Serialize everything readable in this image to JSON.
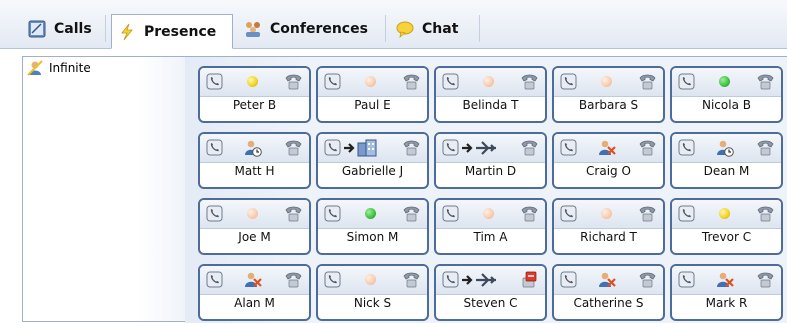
{
  "tabs": [
    {
      "label": "Calls",
      "icon": "calls-icon",
      "active": false
    },
    {
      "label": "Presence",
      "icon": "presence-lightning-icon",
      "active": true
    },
    {
      "label": "Conferences",
      "icon": "conferences-icon",
      "active": false
    },
    {
      "label": "Chat",
      "icon": "chat-bubble-icon",
      "active": false
    }
  ],
  "groups": [
    {
      "label": "Infinite",
      "icon": "user-group-icon"
    }
  ],
  "colors": {
    "available": "#3fbf3f",
    "away": "#f2d21c",
    "offline": "#f7c7a8",
    "card_border": "#4d6c9a"
  },
  "contacts": [
    {
      "name": "Peter B",
      "status": "away-dot"
    },
    {
      "name": "Paul E",
      "status": "offline-dot"
    },
    {
      "name": "Belinda T",
      "status": "offline-dot"
    },
    {
      "name": "Barbara S",
      "status": "offline-dot"
    },
    {
      "name": "Nicola B",
      "status": "available-dot"
    },
    {
      "name": "Matt H",
      "status": "user-clock-icon"
    },
    {
      "name": "Gabrielle J",
      "status": "forward-office-icon"
    },
    {
      "name": "Martin D",
      "status": "forward-airplane-icon"
    },
    {
      "name": "Craig O",
      "status": "user-busy-icon"
    },
    {
      "name": "Dean M",
      "status": "user-clock-icon"
    },
    {
      "name": "Joe M",
      "status": "offline-dot"
    },
    {
      "name": "Simon M",
      "status": "available-dot"
    },
    {
      "name": "Tim A",
      "status": "offline-dot"
    },
    {
      "name": "Richard T",
      "status": "offline-dot"
    },
    {
      "name": "Trevor C",
      "status": "away-dot"
    },
    {
      "name": "Alan M",
      "status": "user-busy-icon"
    },
    {
      "name": "Nick S",
      "status": "offline-dot"
    },
    {
      "name": "Steven C",
      "status": "forward-airplane-icon",
      "handset": "handset-incoming-icon"
    },
    {
      "name": "Catherine S",
      "status": "user-busy-icon"
    },
    {
      "name": "Mark R",
      "status": "user-busy-icon"
    }
  ]
}
